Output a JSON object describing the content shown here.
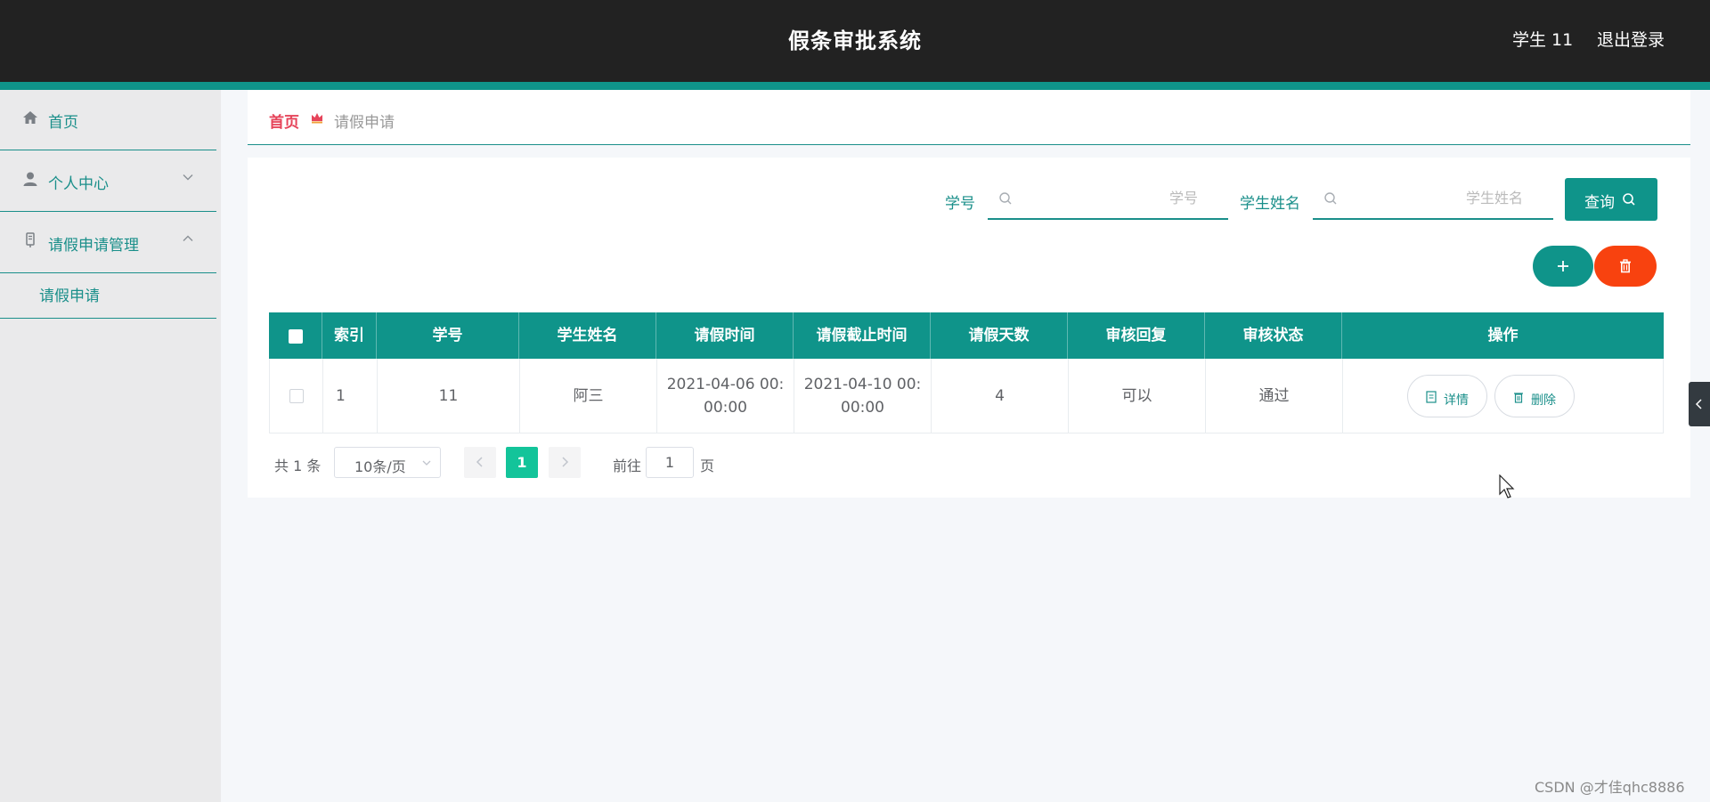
{
  "header": {
    "app_title": "假条审批系统",
    "user_name": "学生 11",
    "logout_label": "退出登录"
  },
  "sidebar": {
    "items": [
      {
        "label": "首页",
        "icon": "home-icon"
      },
      {
        "label": "个人中心",
        "icon": "user-icon",
        "expanded": false
      },
      {
        "label": "请假申请管理",
        "icon": "doc-icon",
        "expanded": true
      }
    ],
    "subitems": [
      {
        "label": "请假申请"
      }
    ]
  },
  "breadcrumb": {
    "home": "首页",
    "current": "请假申请",
    "home_color": "#e6445a"
  },
  "search": {
    "student_no_label": "学号",
    "student_no_placeholder": "学号",
    "student_no_value": "",
    "student_name_label": "学生姓名",
    "student_name_placeholder": "学生姓名",
    "student_name_value": "",
    "query_label": "查询"
  },
  "actions": {
    "add_icon": "plus-icon",
    "delete_icon": "trash-icon"
  },
  "table": {
    "columns": [
      "索引",
      "学号",
      "学生姓名",
      "请假时间",
      "请假截止时间",
      "请假天数",
      "审核回复",
      "审核状态",
      "操作"
    ],
    "rows": [
      {
        "index": "1",
        "student_no": "11",
        "student_name": "阿三",
        "leave_start_l1": "2021-04-06 00:",
        "leave_start_l2": "00:00",
        "leave_end_l1": "2021-04-10 00:",
        "leave_end_l2": "00:00",
        "days": "4",
        "reply": "可以",
        "status": "通过",
        "detail_label": "详情",
        "delete_label": "删除"
      }
    ]
  },
  "pagination": {
    "total_text": "共 1 条",
    "page_size": "10条/页",
    "current_page": "1",
    "goto_label": "前往",
    "goto_value": "1",
    "page_unit": "页"
  },
  "watermark": "CSDN @才佳qhc8886",
  "colors": {
    "accent": "#0f948a",
    "danger": "#f8420f",
    "active_page": "#13c49a",
    "header_bg": "#222222"
  }
}
